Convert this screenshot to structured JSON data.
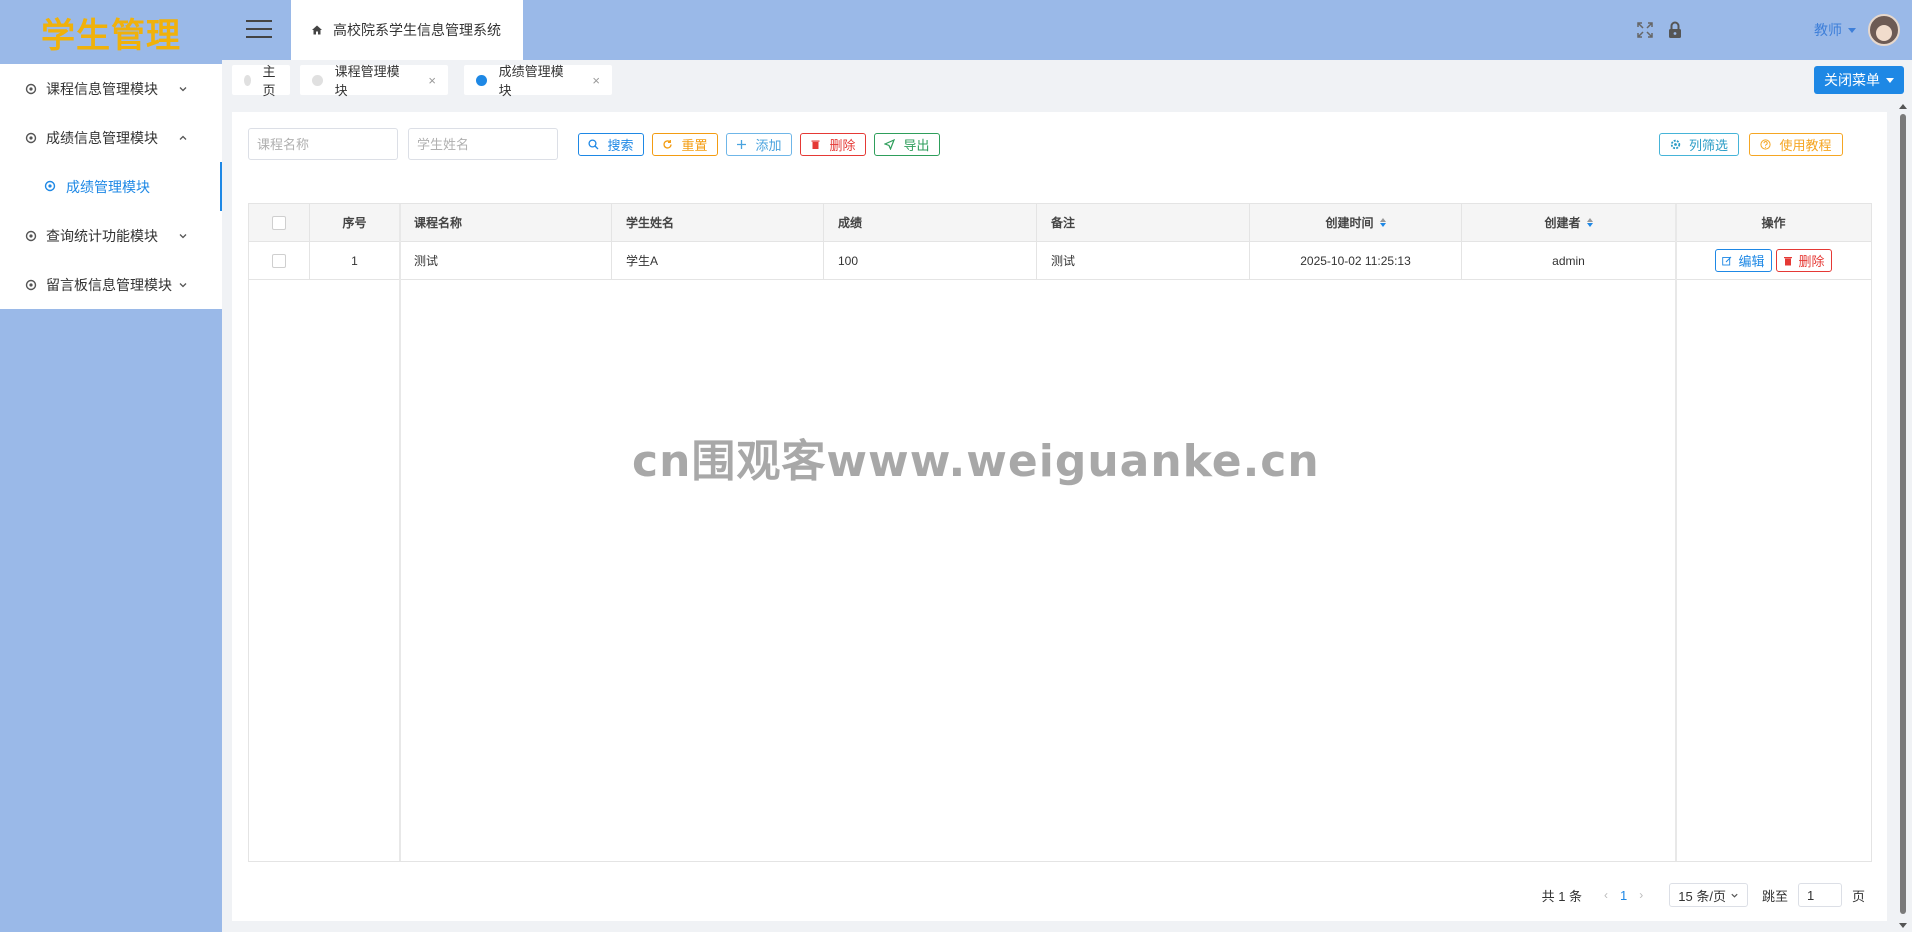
{
  "app": {
    "logo_text": "学生管理",
    "system_title": "高校院系学生信息管理系统",
    "user": "教师"
  },
  "sidebar": {
    "items": [
      {
        "label": "课程信息管理模块",
        "expanded": false
      },
      {
        "label": "成绩信息管理模块",
        "expanded": true
      },
      {
        "label": "成绩管理模块",
        "sub": true,
        "active": true
      },
      {
        "label": "查询统计功能模块",
        "expanded": false
      },
      {
        "label": "留言板信息管理模块",
        "expanded": false
      }
    ]
  },
  "tabs": [
    {
      "label": "主页",
      "closable": false,
      "active": false
    },
    {
      "label": "课程管理模块",
      "closable": true,
      "active": false
    },
    {
      "label": "成绩管理模块",
      "closable": true,
      "active": true
    }
  ],
  "close_menu_label": "关闭菜单",
  "close_symbol": "×",
  "search": {
    "course_placeholder": "课程名称",
    "student_placeholder": "学生姓名"
  },
  "toolbar": {
    "search": "搜索",
    "reset": "重置",
    "add": "添加",
    "delete": "删除",
    "export": "导出",
    "columns": "列筛选",
    "tutorial": "使用教程"
  },
  "table": {
    "columns": [
      "序号",
      "课程名称",
      "学生姓名",
      "成绩",
      "备注",
      "创建时间",
      "创建者",
      "操作"
    ],
    "rows": [
      {
        "index": "1",
        "course": "测试",
        "student": "学生A",
        "score": "100",
        "remark": "测试",
        "created_at": "2025-10-02 11:25:13",
        "creator": "admin"
      }
    ],
    "edit_label": "编辑",
    "delete_label": "删除"
  },
  "watermark": "cn围观客www.weiguanke.cn",
  "pagination": {
    "total_text": "共 1 条",
    "prev": "‹",
    "next": "›",
    "current_page": "1",
    "page_size": "15 条/页",
    "goto_label": "跳至",
    "goto_value": "1",
    "page_suffix": "页"
  },
  "colors": {
    "primary": "#1e88e5",
    "header_bg": "#9ab9e8",
    "logo": "#f0b10a",
    "danger": "#e53935",
    "warning": "#f39c12",
    "success": "#2e9e5b"
  }
}
